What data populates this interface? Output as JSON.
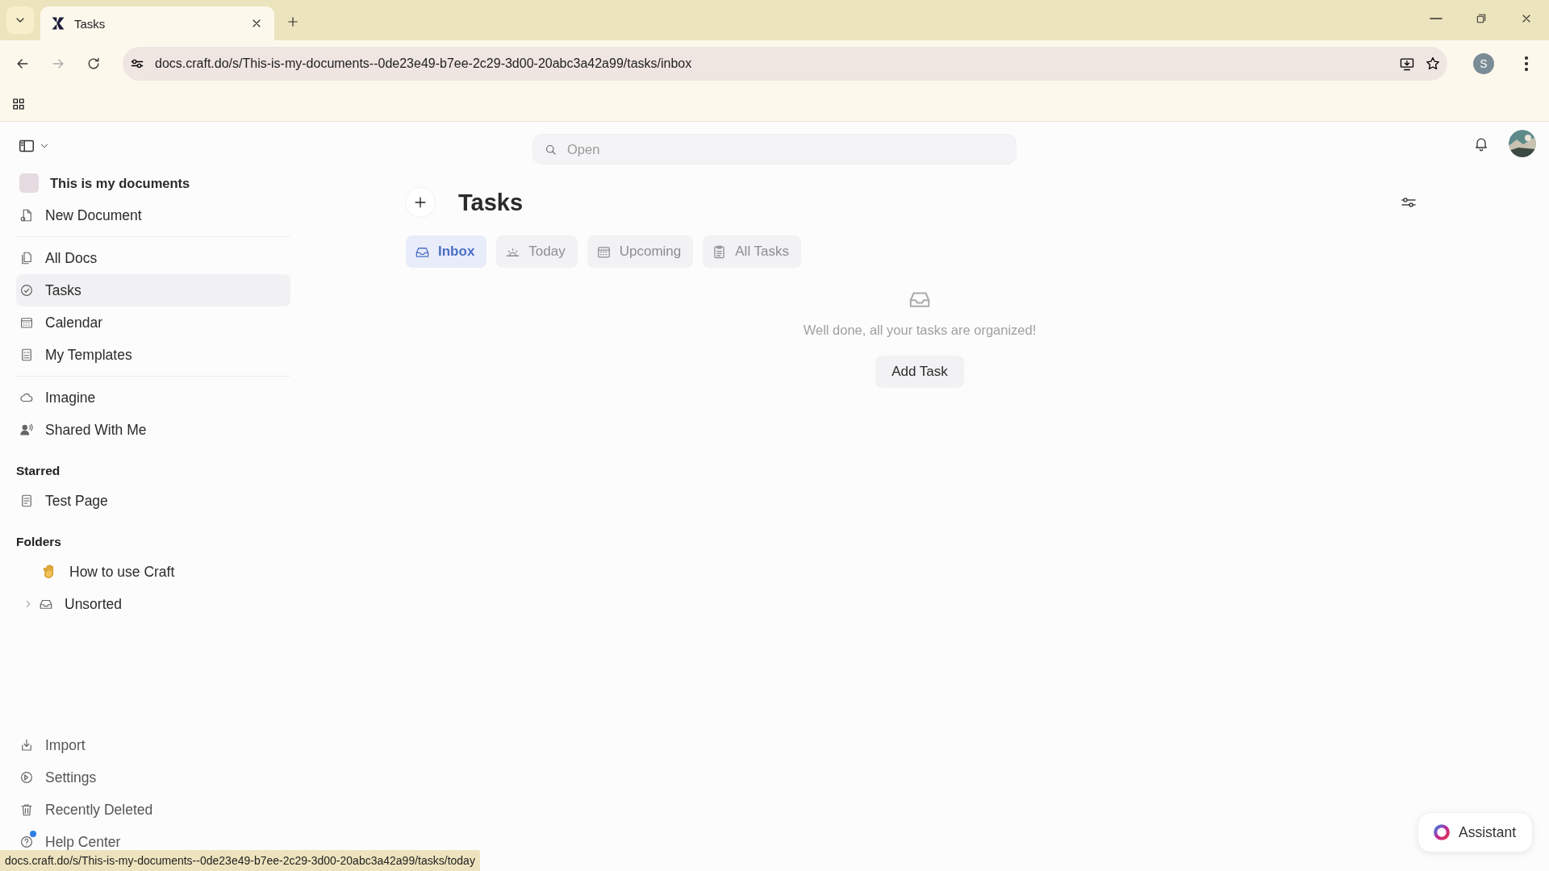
{
  "browser": {
    "tab_title": "Tasks",
    "url": "docs.craft.do/s/This-is-my-documents--0de23e49-b7ee-2c29-3d00-20abc3a42a99/tasks/inbox",
    "profile_initial": "S"
  },
  "sidebar": {
    "space": "This is my documents",
    "top_items": [
      {
        "label": "New Document"
      }
    ],
    "nav_items": [
      {
        "label": "All Docs",
        "selected": false
      },
      {
        "label": "Tasks",
        "selected": true
      },
      {
        "label": "Calendar",
        "selected": false
      },
      {
        "label": "My Templates",
        "selected": false
      }
    ],
    "extra_items": [
      {
        "label": "Imagine"
      },
      {
        "label": "Shared With Me"
      }
    ],
    "starred": {
      "title": "Starred",
      "items": [
        {
          "label": "Test Page"
        }
      ]
    },
    "folders": {
      "title": "Folders",
      "items": [
        {
          "label": "How to use Craft",
          "kind": "emoji"
        },
        {
          "label": "Unsorted",
          "kind": "folder",
          "expanded": false
        }
      ]
    },
    "bottom_items": [
      {
        "label": "Import"
      },
      {
        "label": "Settings"
      },
      {
        "label": "Recently Deleted"
      },
      {
        "label": "Help Center",
        "notification": true
      }
    ]
  },
  "search": {
    "placeholder": "Open"
  },
  "page": {
    "title": "Tasks",
    "tabs": [
      {
        "label": "Inbox",
        "selected": true
      },
      {
        "label": "Today",
        "selected": false
      },
      {
        "label": "Upcoming",
        "selected": false
      },
      {
        "label": "All Tasks",
        "selected": false
      }
    ],
    "empty_message": "Well done, all your tasks are organized!",
    "add_button": "Add Task"
  },
  "assistant_button": "Assistant",
  "status_url": "docs.craft.do/s/This-is-my-documents--0de23e49-b7ee-2c29-3d00-20abc3a42a99/tasks/today"
}
